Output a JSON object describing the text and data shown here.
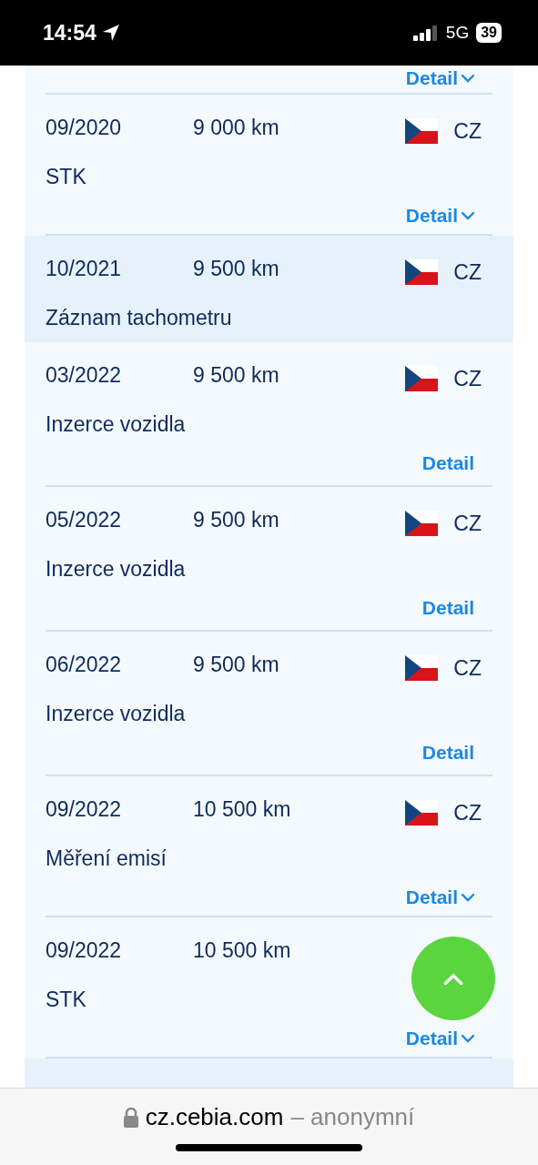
{
  "status_bar": {
    "time": "14:54",
    "network": "5G",
    "battery": "39"
  },
  "records": [
    {
      "detail": "Detail",
      "expandable": true,
      "highlighted": false
    },
    {
      "date": "09/2020",
      "mileage": "9 000 km",
      "country": "CZ",
      "description": "STK",
      "detail": "Detail",
      "expandable": true,
      "highlighted": false
    },
    {
      "date": "10/2021",
      "mileage": "9 500 km",
      "country": "CZ",
      "description": "Záznam tachometru",
      "highlighted": true
    },
    {
      "date": "03/2022",
      "mileage": "9 500 km",
      "country": "CZ",
      "description": "Inzerce vozidla",
      "detail": "Detail",
      "expandable": false,
      "highlighted": false
    },
    {
      "date": "05/2022",
      "mileage": "9 500 km",
      "country": "CZ",
      "description": "Inzerce vozidla",
      "detail": "Detail",
      "expandable": false,
      "highlighted": false
    },
    {
      "date": "06/2022",
      "mileage": "9 500 km",
      "country": "CZ",
      "description": "Inzerce vozidla",
      "detail": "Detail",
      "expandable": false,
      "highlighted": false
    },
    {
      "date": "09/2022",
      "mileage": "10 500 km",
      "country": "CZ",
      "description": "Měření emisí",
      "detail": "Detail",
      "expandable": true,
      "highlighted": false
    },
    {
      "date": "09/2022",
      "mileage": "10 500 km",
      "description": "STK",
      "detail": "Detail",
      "expandable": true,
      "highlighted": false
    },
    {
      "highlighted": true
    }
  ],
  "address_bar": {
    "domain": "cz.cebia.com",
    "suffix": "– anonymní"
  }
}
